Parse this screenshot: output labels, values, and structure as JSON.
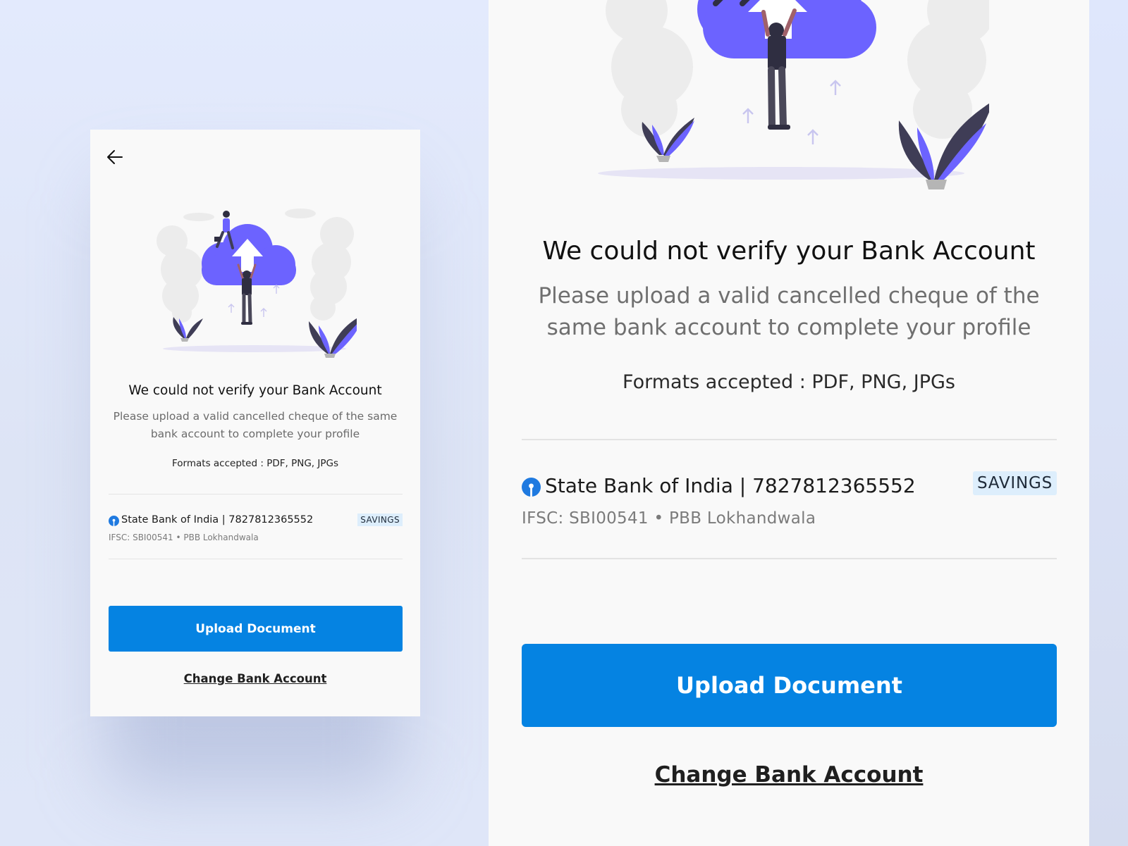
{
  "screen": {
    "back_icon": "arrow-left-icon",
    "title": "We could not verify your Bank Account",
    "subtitle": "Please upload a valid cancelled cheque of the same bank account to complete your profile",
    "formats": "Formats accepted : PDF, PNG, JPGs",
    "bank": {
      "logo_icon": "sbi-logo-icon",
      "name_number": "State Bank of India | 7827812365552",
      "account_type": "SAVINGS",
      "ifsc_details": "IFSC: SBI00541  •  PBB Lokhandwala"
    },
    "upload_button_label": "Upload Document",
    "change_link_label": "Change Bank Account",
    "illustration_icon": "cloud-upload-illustration"
  },
  "colors": {
    "background": "#e3eafd",
    "card": "#f9f9f9",
    "primary_button": "#0583e2",
    "badge_bg": "#ddeefc",
    "illustration_accent": "#6c63ff",
    "bank_logo": "#1f7ae0"
  }
}
